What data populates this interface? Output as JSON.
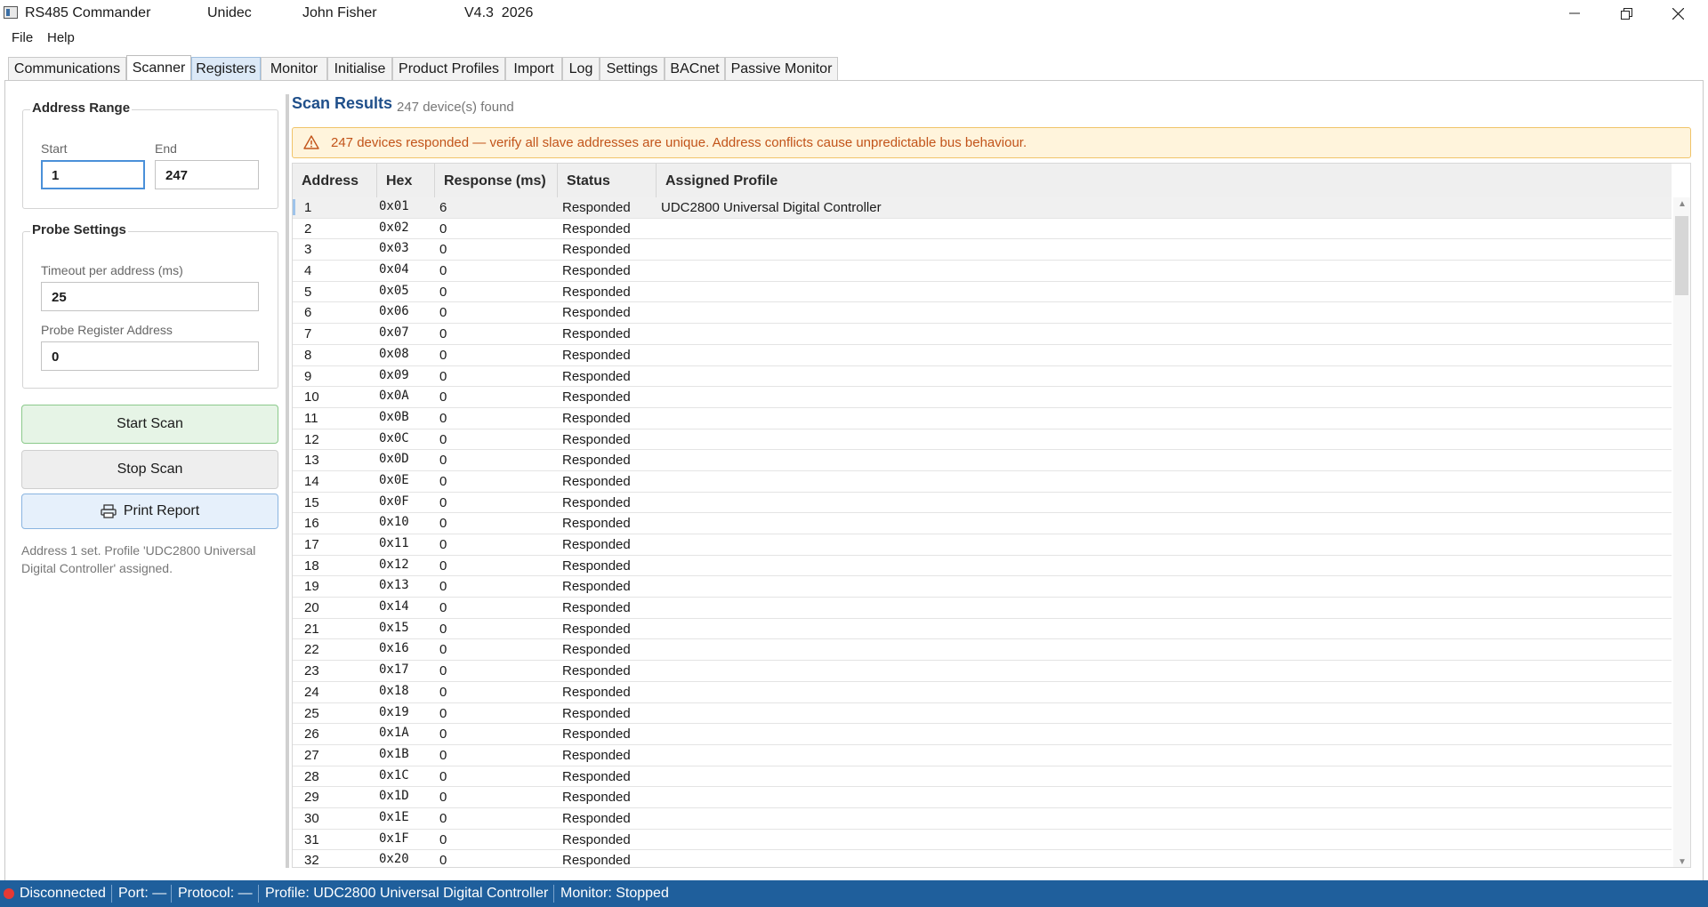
{
  "window": {
    "app_name": "RS485 Commander",
    "company": "Unidec",
    "user": "John Fisher",
    "version": "V4.3  2026"
  },
  "menu": [
    "File",
    "Help"
  ],
  "tabs": [
    "Communications",
    "Scanner",
    "Registers",
    "Monitor",
    "Initialise",
    "Product Profiles",
    "Import",
    "Log",
    "Settings",
    "BACnet",
    "Passive Monitor"
  ],
  "active_tab": "Scanner",
  "address_range": {
    "title": "Address Range",
    "start_label": "Start",
    "start_value": "1",
    "end_label": "End",
    "end_value": "247"
  },
  "probe_settings": {
    "title": "Probe Settings",
    "timeout_label": "Timeout per address (ms)",
    "timeout_value": "25",
    "register_label": "Probe Register Address",
    "register_value": "0"
  },
  "buttons": {
    "start": "Start Scan",
    "stop": "Stop Scan",
    "print": "Print Report"
  },
  "status_message": "Address 1 set.  Profile 'UDC2800 Universal Digital Controller' assigned.",
  "results": {
    "title": "Scan Results",
    "count": "247 device(s) found",
    "warning": "247  devices responded — verify all slave addresses are unique. Address conflicts cause unpredictable bus behaviour.",
    "columns": [
      "Address",
      "Hex",
      "Response (ms)",
      "Status",
      "Assigned Profile"
    ],
    "rows": [
      [
        "1",
        "0x01",
        "6",
        "Responded",
        "UDC2800 Universal Digital Controller"
      ],
      [
        "2",
        "0x02",
        "0",
        "Responded",
        ""
      ],
      [
        "3",
        "0x03",
        "0",
        "Responded",
        ""
      ],
      [
        "4",
        "0x04",
        "0",
        "Responded",
        ""
      ],
      [
        "5",
        "0x05",
        "0",
        "Responded",
        ""
      ],
      [
        "6",
        "0x06",
        "0",
        "Responded",
        ""
      ],
      [
        "7",
        "0x07",
        "0",
        "Responded",
        ""
      ],
      [
        "8",
        "0x08",
        "0",
        "Responded",
        ""
      ],
      [
        "9",
        "0x09",
        "0",
        "Responded",
        ""
      ],
      [
        "10",
        "0x0A",
        "0",
        "Responded",
        ""
      ],
      [
        "11",
        "0x0B",
        "0",
        "Responded",
        ""
      ],
      [
        "12",
        "0x0C",
        "0",
        "Responded",
        ""
      ],
      [
        "13",
        "0x0D",
        "0",
        "Responded",
        ""
      ],
      [
        "14",
        "0x0E",
        "0",
        "Responded",
        ""
      ],
      [
        "15",
        "0x0F",
        "0",
        "Responded",
        ""
      ],
      [
        "16",
        "0x10",
        "0",
        "Responded",
        ""
      ],
      [
        "17",
        "0x11",
        "0",
        "Responded",
        ""
      ],
      [
        "18",
        "0x12",
        "0",
        "Responded",
        ""
      ],
      [
        "19",
        "0x13",
        "0",
        "Responded",
        ""
      ],
      [
        "20",
        "0x14",
        "0",
        "Responded",
        ""
      ],
      [
        "21",
        "0x15",
        "0",
        "Responded",
        ""
      ],
      [
        "22",
        "0x16",
        "0",
        "Responded",
        ""
      ],
      [
        "23",
        "0x17",
        "0",
        "Responded",
        ""
      ],
      [
        "24",
        "0x18",
        "0",
        "Responded",
        ""
      ],
      [
        "25",
        "0x19",
        "0",
        "Responded",
        ""
      ],
      [
        "26",
        "0x1A",
        "0",
        "Responded",
        ""
      ],
      [
        "27",
        "0x1B",
        "0",
        "Responded",
        ""
      ],
      [
        "28",
        "0x1C",
        "0",
        "Responded",
        ""
      ],
      [
        "29",
        "0x1D",
        "0",
        "Responded",
        ""
      ],
      [
        "30",
        "0x1E",
        "0",
        "Responded",
        ""
      ],
      [
        "31",
        "0x1F",
        "0",
        "Responded",
        ""
      ],
      [
        "32",
        "0x20",
        "0",
        "Responded",
        ""
      ]
    ]
  },
  "statusbar": {
    "connection": "Disconnected",
    "port": "Port: —",
    "protocol": "Protocol: —",
    "profile": "Profile: UDC2800 Universal Digital Controller",
    "monitor": "Monitor: Stopped"
  },
  "colors": {
    "accent": "#1f5f9c",
    "warning_bg": "#fff4dc",
    "warning_text": "#c2541a",
    "disconnected": "#e53935"
  }
}
